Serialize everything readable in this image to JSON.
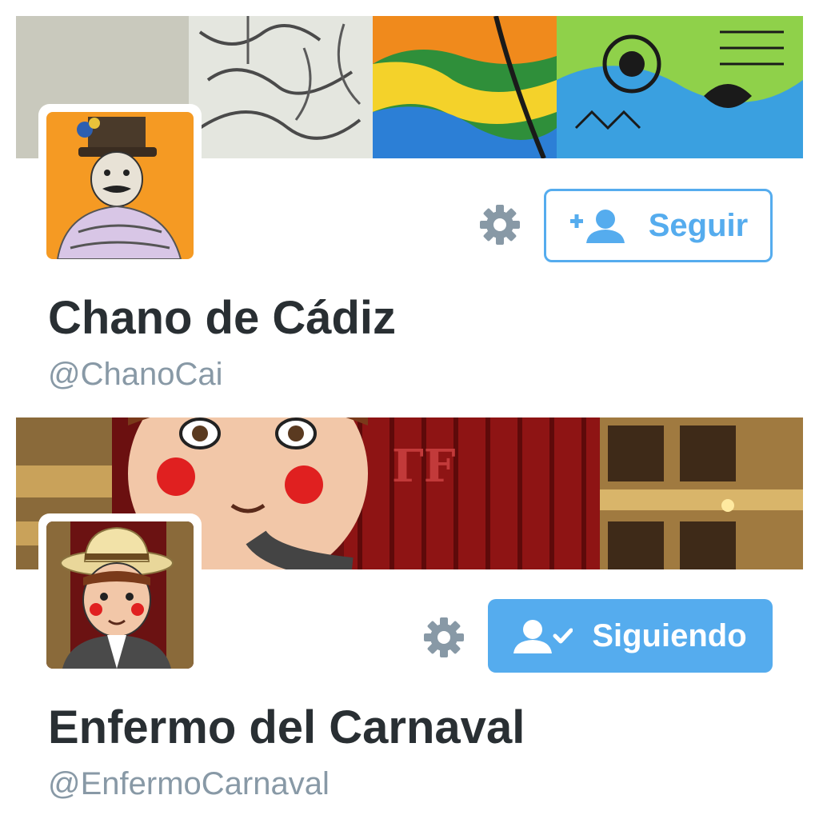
{
  "profiles": [
    {
      "display_name": "Chano de Cádiz",
      "handle": "@ChanoCai",
      "follow_label": "Seguir",
      "follow_state": "not-following"
    },
    {
      "display_name": "Enfermo del Carnaval",
      "handle": "@EnfermoCarnaval",
      "follow_label": "Siguiendo",
      "follow_state": "following"
    }
  ],
  "colors": {
    "accent": "#55acee",
    "name_text": "#292f33",
    "handle_text": "#8899a6",
    "gear": "#8899a6"
  },
  "icons": {
    "settings": "gear-icon",
    "follow": "add-user-icon",
    "following": "user-check-icon"
  }
}
